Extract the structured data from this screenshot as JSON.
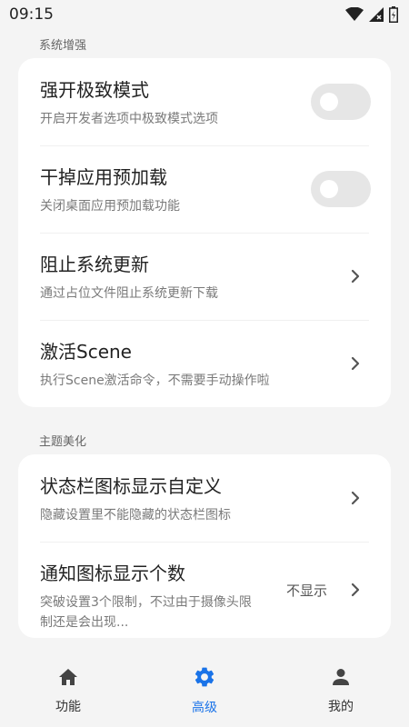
{
  "status_bar": {
    "time": "09:15"
  },
  "sections": [
    {
      "title": "系统增强",
      "items": [
        {
          "title": "强开极致模式",
          "desc": "开启开发者选项中极致模式选项",
          "control": "toggle",
          "on": false
        },
        {
          "title": "干掉应用预加载",
          "desc": "关闭桌面应用预加载功能",
          "control": "toggle",
          "on": false
        },
        {
          "title": "阻止系统更新",
          "desc": "通过占位文件阻止系统更新下载",
          "control": "chevron"
        },
        {
          "title": "激活Scene",
          "desc": "执行Scene激活命令，不需要手动操作啦",
          "control": "chevron"
        }
      ]
    },
    {
      "title": "主题美化",
      "items": [
        {
          "title": "状态栏图标显示自定义",
          "desc": "隐藏设置里不能隐藏的状态栏图标",
          "control": "chevron"
        },
        {
          "title": "通知图标显示个数",
          "desc": "突破设置3个限制，不过由于摄像头限制还是会出现...",
          "control": "chevron",
          "value": "不显示"
        }
      ]
    }
  ],
  "nav": {
    "items": [
      {
        "label": "功能",
        "icon": "home-icon",
        "active": false
      },
      {
        "label": "高级",
        "icon": "gear-icon",
        "active": true
      },
      {
        "label": "我的",
        "icon": "person-icon",
        "active": false
      }
    ]
  },
  "colors": {
    "accent": "#1a73e8",
    "background": "#f4f4f4",
    "card": "#ffffff"
  }
}
